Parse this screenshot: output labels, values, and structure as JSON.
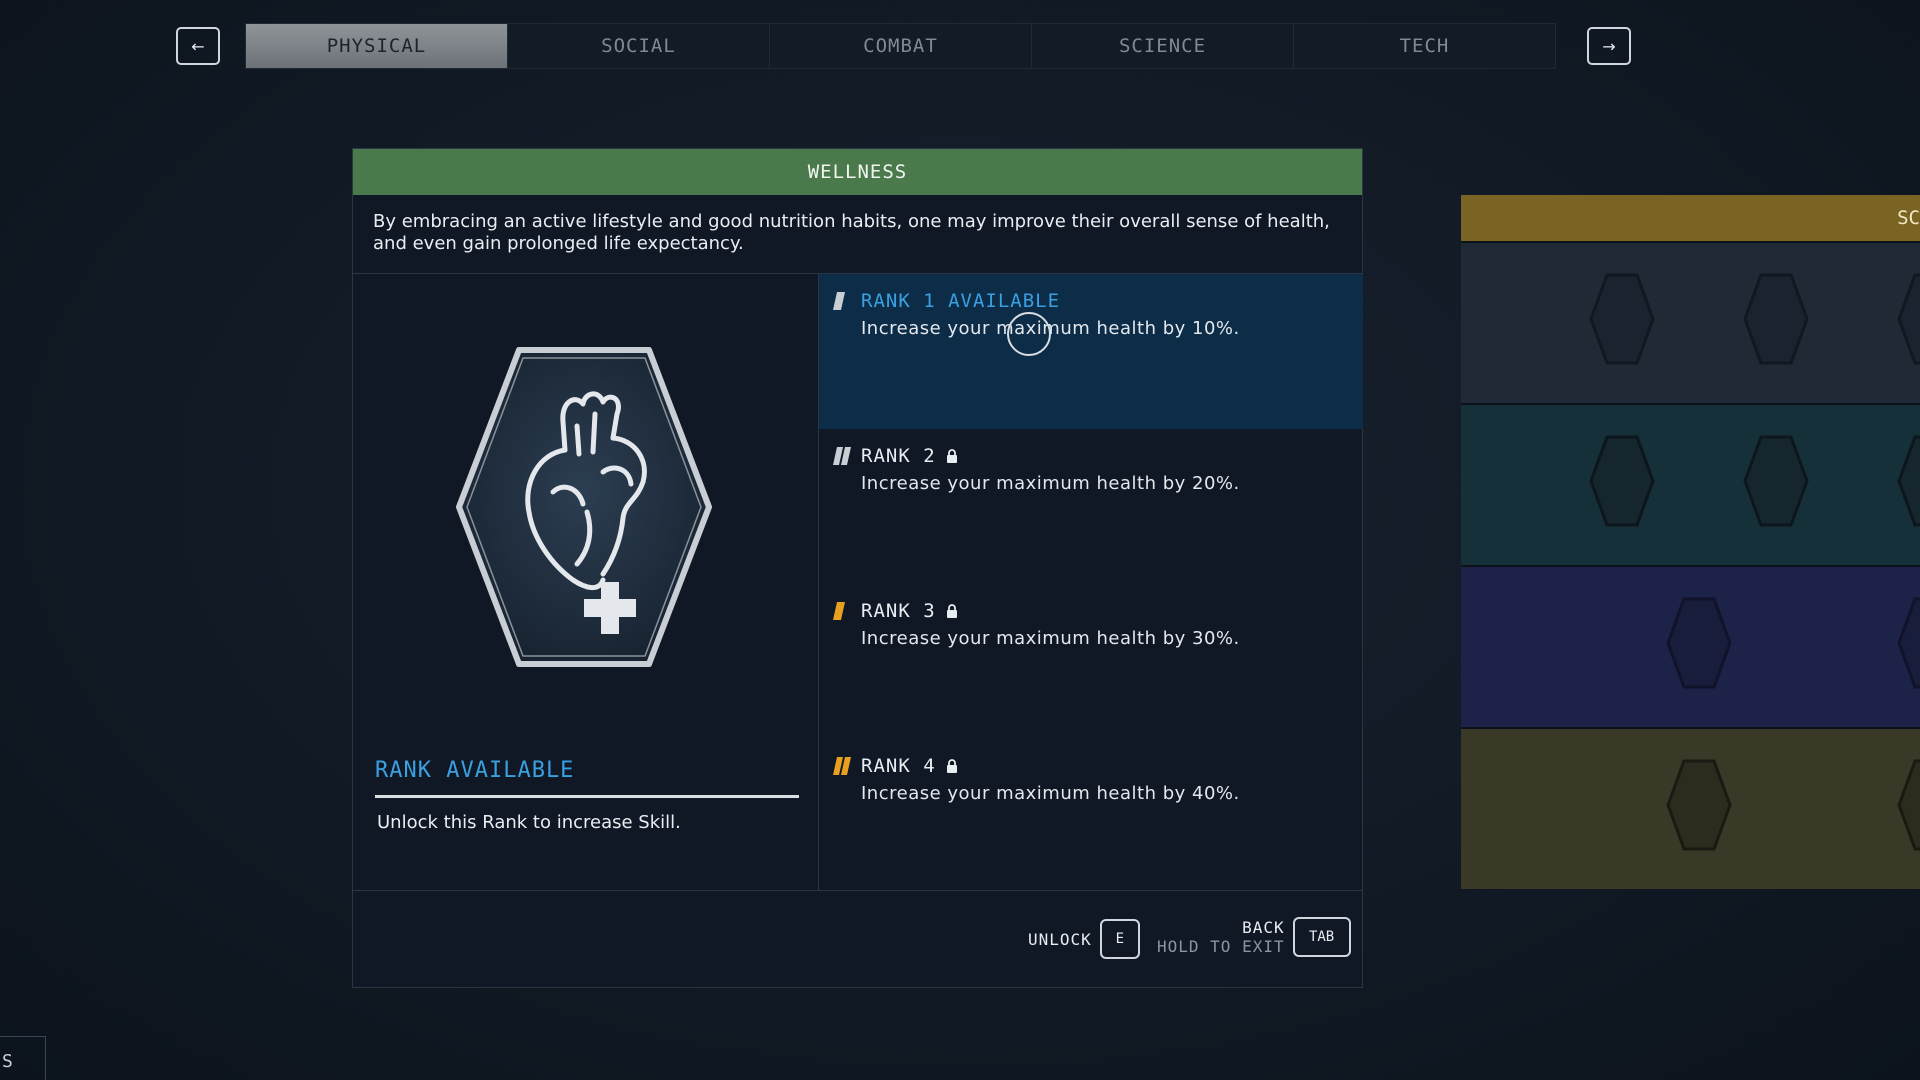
{
  "nav": {
    "prev_icon": "arrow-left-icon",
    "next_icon": "arrow-right-icon",
    "prev_glyph": "←",
    "next_glyph": "→",
    "tabs": [
      {
        "label": "PHYSICAL",
        "active": true
      },
      {
        "label": "SOCIAL",
        "active": false
      },
      {
        "label": "COMBAT",
        "active": false
      },
      {
        "label": "SCIENCE",
        "active": false
      },
      {
        "label": "TECH",
        "active": false
      }
    ]
  },
  "skill": {
    "name": "WELLNESS",
    "description": "By embracing an active lifestyle and good nutrition habits, one may improve their overall sense of health, and even gain prolonged life expectancy.",
    "icon": "heart-plus-icon",
    "rank_status": "RANK AVAILABLE",
    "rank_hint": "Unlock this Rank to increase Skill."
  },
  "ranks": [
    {
      "title": "RANK 1 AVAILABLE",
      "description": "Increase your maximum health by 10%.",
      "locked": false,
      "selected": true,
      "color": "#3aa0e0"
    },
    {
      "title": "RANK 2",
      "description": "Increase your maximum health by 20%.",
      "locked": true,
      "selected": false,
      "color": "#e8edf2"
    },
    {
      "title": "RANK 3",
      "description": "Increase your maximum health by 30%.",
      "locked": true,
      "selected": false,
      "color": "#e8edf2"
    },
    {
      "title": "RANK 4",
      "description": "Increase your maximum health by 40%.",
      "locked": true,
      "selected": false,
      "color": "#e8edf2"
    }
  ],
  "footer": {
    "unlock_label": "UNLOCK",
    "unlock_key": "E",
    "back_label": "BACK",
    "hold_label": "HOLD TO EXIT",
    "back_key": "TAB"
  },
  "side_panel": {
    "header_label": "SC",
    "accent": "#7a6424"
  },
  "corner": {
    "label": "S"
  },
  "colors": {
    "header_green": "#4a7a4c",
    "selected_row": "#0d2c47",
    "available_blue": "#3aa0e0",
    "rank_marker_gray": "#c9ced4",
    "rank_marker_orange": "#e8a020"
  }
}
